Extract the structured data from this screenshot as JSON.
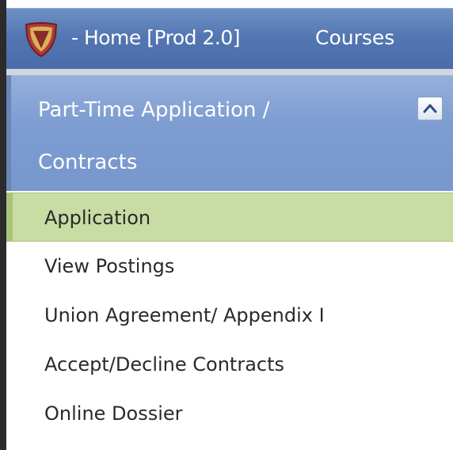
{
  "topbar": {
    "home_label": "- Home [Prod 2.0]",
    "courses_label": "Courses"
  },
  "section": {
    "title_line1": "Part-Time Application /",
    "title_line2": "Contracts",
    "collapse_icon": "chevron-up-icon"
  },
  "menu": {
    "items": [
      {
        "label": "Application",
        "selected": true
      },
      {
        "label": "View Postings",
        "selected": false
      },
      {
        "label": "Union Agreement/ Appendix I",
        "selected": false
      },
      {
        "label": "Accept/Decline Contracts",
        "selected": false
      },
      {
        "label": "Online Dossier",
        "selected": false
      }
    ]
  },
  "colors": {
    "topbar": "#5477b3",
    "section_header": "#7e9dd1",
    "selected_item": "#c9dca4"
  }
}
